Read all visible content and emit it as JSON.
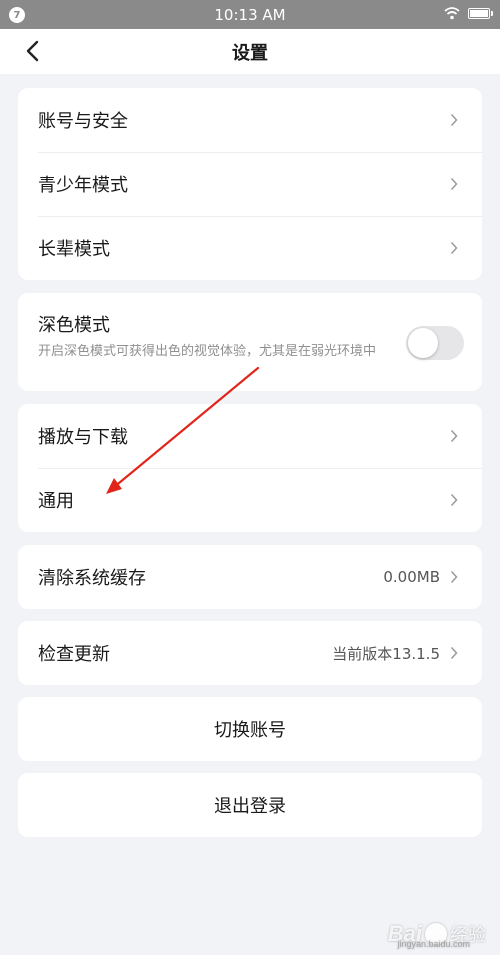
{
  "status_bar": {
    "time": "10:13 AM",
    "notification_badge": "7"
  },
  "nav": {
    "title": "设置"
  },
  "group1": {
    "items": [
      {
        "label": "账号与安全"
      },
      {
        "label": "青少年模式"
      },
      {
        "label": "长辈模式"
      }
    ]
  },
  "dark_mode": {
    "label": "深色模式",
    "description": "开启深色模式可获得出色的视觉体验，尤其是在弱光环境中",
    "enabled": false
  },
  "group3": {
    "items": [
      {
        "label": "播放与下载"
      },
      {
        "label": "通用"
      }
    ]
  },
  "cache": {
    "label": "清除系统缓存",
    "value": "0.00MB"
  },
  "update": {
    "label": "检查更新",
    "value": "当前版本13.1.5"
  },
  "switch_account": {
    "label": "切换账号"
  },
  "logout": {
    "label": "退出登录"
  },
  "annotation": {
    "arrow_color": "#e0251b"
  },
  "watermark": {
    "brand": "Bai",
    "brand_suffix": "经验",
    "url": "jingyan.baidu.com"
  },
  "colors": {
    "background": "#f2f3f7",
    "status_bar": "#8a8a8a",
    "card": "#ffffff"
  },
  "icons": {
    "back": "chevron-left-icon",
    "row_arrow": "chevron-right-icon",
    "wifi": "wifi-icon",
    "battery": "battery-icon"
  }
}
